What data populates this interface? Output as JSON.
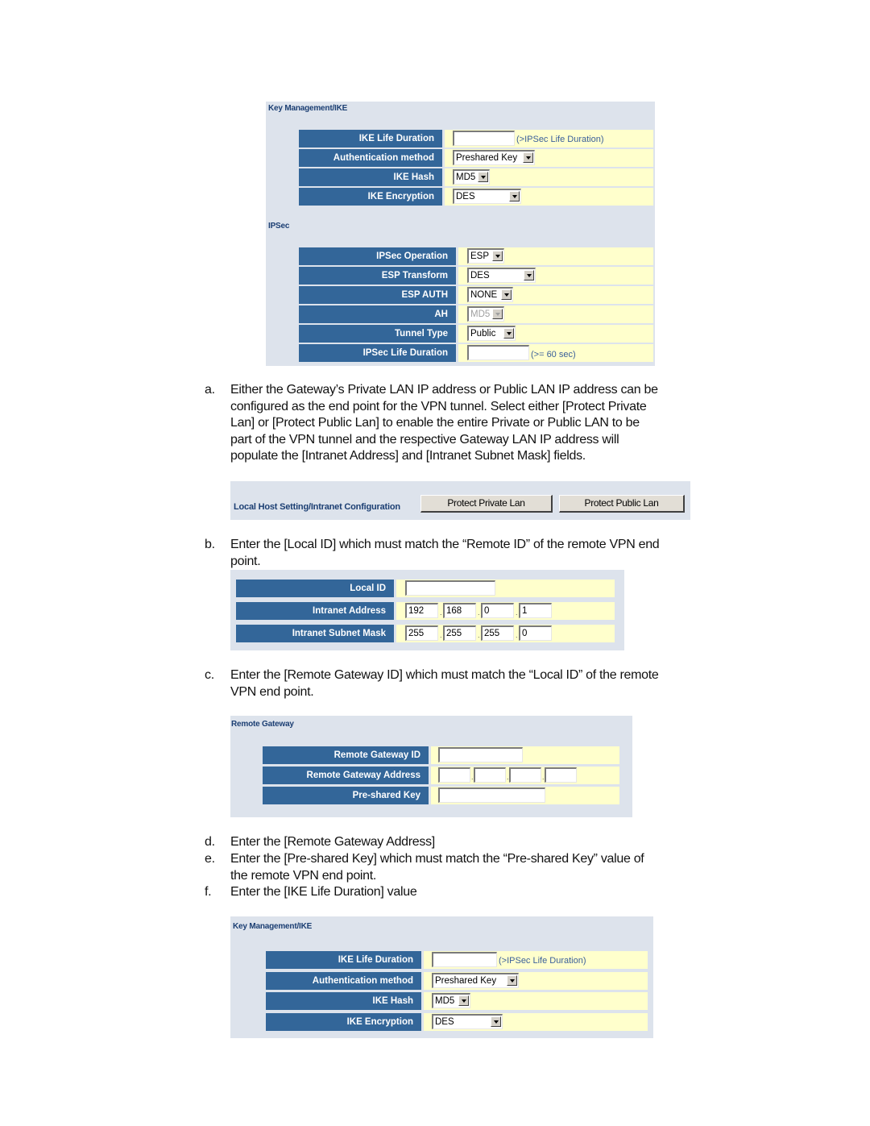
{
  "panel1": {
    "title": "Key Management/IKE",
    "rows": [
      {
        "label": "IKE Life Duration",
        "value": "",
        "hint": "(>IPSec Life Duration)"
      },
      {
        "label": "Authentication method",
        "value": "Preshared Key"
      },
      {
        "label": "IKE Hash",
        "value": "MD5"
      },
      {
        "label": "IKE Encryption",
        "value": "DES"
      }
    ],
    "ipsec_title": "IPSec",
    "ipsec_rows": [
      {
        "label": "IPSec Operation",
        "value": "ESP"
      },
      {
        "label": "ESP Transform",
        "value": "DES"
      },
      {
        "label": "ESP AUTH",
        "value": "NONE"
      },
      {
        "label": "AH",
        "value": "MD5",
        "disabled": true
      },
      {
        "label": "Tunnel Type",
        "value": "Public"
      },
      {
        "label": "IPSec Life Duration",
        "value": "",
        "hint": "(>= 60 sec)"
      }
    ]
  },
  "steps": {
    "a": {
      "marker": "a.",
      "lines": [
        "Either the Gateway’s Private LAN IP address or Public LAN IP address can be",
        "configured as the end point for the VPN tunnel.  Select either [Protect Private",
        "Lan] or [Protect Public Lan] to enable the entire Private or Public LAN to be",
        "part of the VPN tunnel and the respective Gateway LAN IP address will",
        "populate the [Intranet Address] and [Intranet Subnet Mask] fields."
      ]
    },
    "b": {
      "marker": "b.",
      "lines": [
        "Enter the [Local ID] which must match the “Remote ID” of the remote VPN end",
        "point."
      ]
    },
    "c": {
      "marker": "c.",
      "lines": [
        "Enter the [Remote Gateway ID] which must match the “Local ID” of the remote",
        "VPN end point."
      ]
    },
    "d": {
      "marker": "d.",
      "lines": [
        "Enter the [Remote Gateway Address]"
      ]
    },
    "e": {
      "marker": "e.",
      "lines": [
        "Enter the [Pre-shared Key] which must match the “Pre-shared Key” value of",
        "the remote VPN end point."
      ]
    },
    "f": {
      "marker": "f.",
      "lines": [
        "Enter the [IKE Life Duration] value"
      ]
    }
  },
  "local_host": {
    "title": "Local Host Setting/Intranet Configuration",
    "protect_private_label": "Protect Private Lan",
    "protect_public_label": "Protect Public Lan"
  },
  "local_id_panel": {
    "local_id": {
      "label": "Local ID",
      "value": ""
    },
    "intranet_address": {
      "label": "Intranet Address",
      "octets": [
        "192",
        "168",
        "0",
        "1"
      ]
    },
    "intranet_subnet_mask": {
      "label": "Intranet Subnet Mask",
      "octets": [
        "255",
        "255",
        "255",
        "0"
      ]
    }
  },
  "remote_gateway": {
    "title": "Remote Gateway",
    "gateway_id": {
      "label": "Remote Gateway ID",
      "value": ""
    },
    "gateway_address": {
      "label": "Remote Gateway Address",
      "octets": [
        "",
        "",
        "",
        ""
      ]
    },
    "preshared_key": {
      "label": "Pre-shared Key",
      "value": ""
    }
  },
  "panel2": {
    "title": "Key Management/IKE",
    "rows": [
      {
        "label": "IKE Life Duration",
        "value": "",
        "hint": "(>IPSec Life Duration)"
      },
      {
        "label": "Authentication method",
        "value": "Preshared Key"
      },
      {
        "label": "IKE Hash",
        "value": "MD5"
      },
      {
        "label": "IKE Encryption",
        "value": "DES"
      }
    ]
  }
}
